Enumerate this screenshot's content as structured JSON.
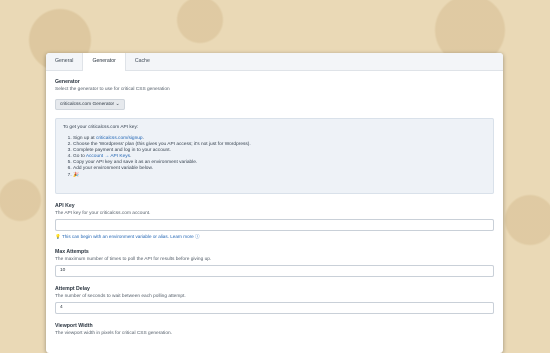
{
  "tabs": [
    {
      "label": "General"
    },
    {
      "label": "Generator"
    },
    {
      "label": "Cache"
    }
  ],
  "generator": {
    "label": "Generator",
    "description": "Select the generator to use for critical CSS generation",
    "selected": "criticalcss.com Generator"
  },
  "info": {
    "intro": "To get your criticalcss.com API key:",
    "steps": [
      {
        "prefix": "Sign up at ",
        "link": "criticalcss.com/signup",
        "suffix": "."
      },
      {
        "prefix": "Choose the 'Wordpress' plan (this gives you API access; it's not just for Wordpress).",
        "link": "",
        "suffix": ""
      },
      {
        "prefix": "Complete payment and log in to your account.",
        "link": "",
        "suffix": ""
      },
      {
        "prefix": "Go to ",
        "link": "Account → API Keys",
        "suffix": "."
      },
      {
        "prefix": "Copy your API key and save it as an environment variable.",
        "link": "",
        "suffix": ""
      },
      {
        "prefix": "Add your environment variable below.",
        "link": "",
        "suffix": ""
      },
      {
        "prefix": "🎉",
        "link": "",
        "suffix": ""
      }
    ]
  },
  "api_key": {
    "label": "API Key",
    "description": "The API key for your criticalcss.com account.",
    "value": "",
    "tip": "This can begin with an environment variable or alias.",
    "learn_more": "Learn more"
  },
  "max_attempts": {
    "label": "Max Attempts",
    "description": "The maximum number of times to poll the API for results before giving up.",
    "value": "10"
  },
  "attempt_delay": {
    "label": "Attempt Delay",
    "description": "The number of seconds to wait between each polling attempt.",
    "value": "4"
  },
  "viewport_width": {
    "label": "Viewport Width",
    "description": "The viewport width in pixels for critical CSS generation."
  }
}
